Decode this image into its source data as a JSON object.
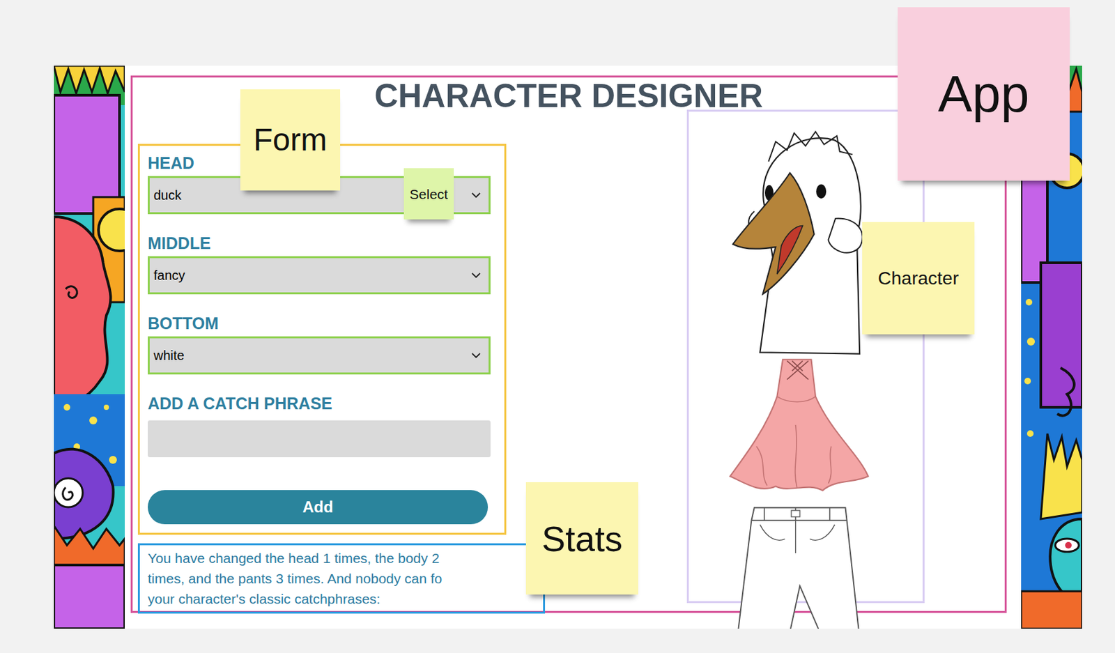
{
  "app": {
    "title": "CHARACTER DESIGNER"
  },
  "form": {
    "fields": [
      {
        "label": "HEAD",
        "value": "duck",
        "kind": "select"
      },
      {
        "label": "MIDDLE",
        "value": "fancy",
        "kind": "select"
      },
      {
        "label": "BOTTOM",
        "value": "white",
        "kind": "select"
      },
      {
        "label": "ADD A CATCH PHRASE",
        "value": "",
        "kind": "text"
      }
    ],
    "button": "Add"
  },
  "stats": {
    "lines": [
      "You have changed the head 1 times, the body 2",
      "times, and the pants 3 times. And nobody can fo",
      "your character's classic catchphrases:"
    ]
  },
  "notes": [
    {
      "label": "App",
      "color": "#f9cfdd"
    },
    {
      "label": "Form",
      "color": "#fcf6b1"
    },
    {
      "label": "Select",
      "color": "#def5a9"
    },
    {
      "label": "Character",
      "color": "#fcf6b1"
    },
    {
      "label": "Stats",
      "color": "#fcf6b1"
    }
  ]
}
